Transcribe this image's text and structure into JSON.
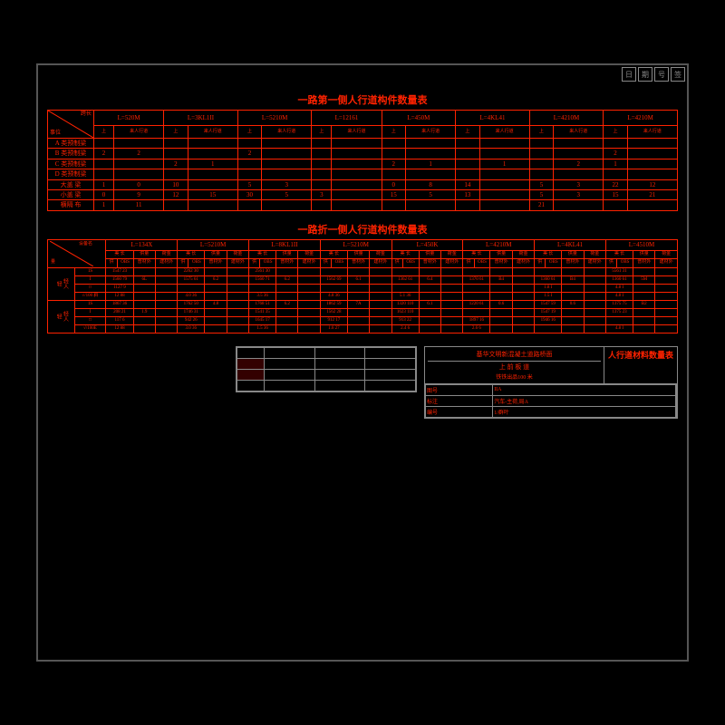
{
  "page": {
    "background": "#000000",
    "border_color": "#555555"
  },
  "corner_marks": [
    "日",
    "期",
    "号",
    "签"
  ],
  "section1": {
    "title": "一路第一侧人行道构件数量表",
    "header_row1": [
      "跨长",
      "L=520M",
      "L=3KL1II",
      "L=5210M",
      "L=12161",
      "L=450M",
      "L=4KL41",
      "L=4210M",
      "L=4210M"
    ],
    "header_row2": [
      "事位",
      "上 采人行道边",
      "来人行道边",
      "来人行道边",
      "来人行道边",
      "来人行道边",
      "来人行道边",
      "来人行道边",
      "来人行道边"
    ],
    "rows": [
      {
        "label": "A 类预制梁",
        "values": [
          "",
          "",
          "",
          "",
          "",
          "",
          "",
          "",
          "",
          "",
          "",
          "",
          "",
          "",
          "",
          "",
          "",
          "",
          ""
        ]
      },
      {
        "label": "B 类预制梁",
        "values": [
          "2",
          "2",
          "",
          "",
          "2",
          "",
          "",
          "",
          "",
          "",
          "",
          "",
          "",
          "",
          "",
          "",
          "",
          "2",
          ""
        ]
      },
      {
        "label": "C 类预制梁",
        "values": [
          "",
          "",
          "2",
          "1",
          "",
          "",
          "",
          "",
          "2",
          "1",
          "",
          "1",
          "",
          "2",
          "1",
          "",
          "",
          "",
          ""
        ]
      },
      {
        "label": "D 类预制梁",
        "values": [
          "",
          "",
          "",
          "",
          "",
          "",
          "",
          "",
          "",
          "",
          "",
          "",
          "",
          "",
          "",
          "",
          "",
          "",
          ""
        ]
      },
      {
        "label": "大盖 梁",
        "values": [
          "1",
          "0",
          "10",
          "",
          "5",
          "3",
          "",
          "",
          "0",
          "8",
          "14",
          "",
          "5",
          "3",
          "",
          "22",
          "12",
          "",
          ""
        ]
      },
      {
        "label": "小盖 梁",
        "values": [
          "0",
          "9",
          "12",
          "15",
          "30",
          "5",
          "3",
          "",
          "15",
          "5",
          "13",
          "",
          "5",
          "3",
          "",
          "15",
          "21",
          "3",
          ""
        ]
      },
      {
        "label": "横隔 布",
        "values": [
          "1",
          "11",
          "",
          "",
          "",
          "",
          "",
          "",
          "",
          "",
          "",
          "",
          "",
          "",
          "21",
          "",
          "",
          "",
          ""
        ]
      }
    ]
  },
  "section2": {
    "title": "一路折一侧人行道构件数量表",
    "col_headers": [
      "设备名数量",
      "L=134X",
      "L=5210M",
      "L=8KL1II",
      "L=5210M",
      "L=450K",
      "L=4210M",
      "L=4KL41",
      "L=4510M"
    ],
    "sub_headers": [
      "美 长 供 量 荷 金 荷 荷 建材 外",
      "美 长 供 量 荷 金 荷 荷 建材 外",
      "美 长 供 量 荷 金 荷 荷 建材 外"
    ],
    "groups": [
      {
        "group_label": "轻人",
        "rows": [
          {
            "type": "1S",
            "values": [
              "1547 23",
              "",
              "2262 30",
              "",
              "2561 30",
              "",
              "",
              "",
              "",
              "",
              "",
              "",
              "",
              "",
              "",
              "5561 31"
            ]
          },
          {
            "type": "I",
            "values": [
              "1560 79",
              "6L",
              "1575 61",
              "6.2",
              "1560 71",
              "6.2",
              "1562 69",
              "6.1",
              "1362 61",
              "6.4",
              "1370 61",
              "B4",
              "1360 61",
              "B4",
              "1360 61",
              "5M"
            ]
          },
          {
            "type": "□",
            "values": [
              "1127 9",
              "",
              "",
              "",
              "",
              "",
              "",
              "",
              "",
              "",
              "",
              "",
              "",
              "1.8 I",
              "",
              "4.8 I"
            ]
          },
          {
            "type": "√/100 斜",
            "values": [
              "12 88",
              "",
              "4.0 36",
              "",
              "3.5 36",
              "",
              "4.8 36",
              "",
              "5.1 36",
              "",
              "",
              "",
              "1.5 I",
              "",
              "4.8 I"
            ]
          }
        ]
      },
      {
        "group_label": "轻人",
        "rows": [
          {
            "type": "1S",
            "values": [
              "1867 36",
              "",
              "1762 50",
              "4.8",
              "1768 51",
              "6.2",
              "1862 59",
              "7A",
              "1320 110",
              "6.1",
              "1220 61",
              "0.6",
              "1547 59",
              "0.6",
              "1375 75",
              "B2"
            ]
          },
          {
            "type": "I",
            "values": [
              "208 21",
              "1.9",
              "1746 31",
              "",
              "1541 35",
              "",
              "1562 28",
              "",
              "1623 110",
              "",
              "",
              "",
              "1547 19",
              "",
              "1375 23",
              ""
            ]
          },
          {
            "type": "□",
            "values": [
              "117 6",
              "",
              "942 26",
              "",
              "1645 17",
              "",
              "912 17",
              "",
              "913 22",
              "",
              "1897 16",
              "",
              "1946 16",
              "",
              ""
            ]
          },
          {
            "type": "√/100E",
            "values": [
              "12 88",
              "",
              "3.0 36",
              "",
              "1.5 36",
              "",
              "1.6 27",
              "",
              "2.4 6",
              "",
              "2.6 6",
              "",
              "",
              "",
              "4.8 I"
            ]
          }
        ]
      }
    ]
  },
  "bottom_info": {
    "title": "人行道材料数量表",
    "company": "基华文明新混凝土道路桥面",
    "subtitle": "上 前 板 道",
    "note": "铁铁出品100 米",
    "table_rows": [
      [
        "",
        "",
        "",
        ""
      ],
      [
        "",
        "",
        "",
        ""
      ],
      [
        "",
        "",
        "",
        ""
      ],
      [
        "",
        "",
        "",
        ""
      ]
    ],
    "legend_left": [
      "",
      "",
      ""
    ],
    "right_section": {
      "图号": "IIA",
      "标注": "汽车-主荷,局A",
      "编号": "1/群叶"
    }
  }
}
